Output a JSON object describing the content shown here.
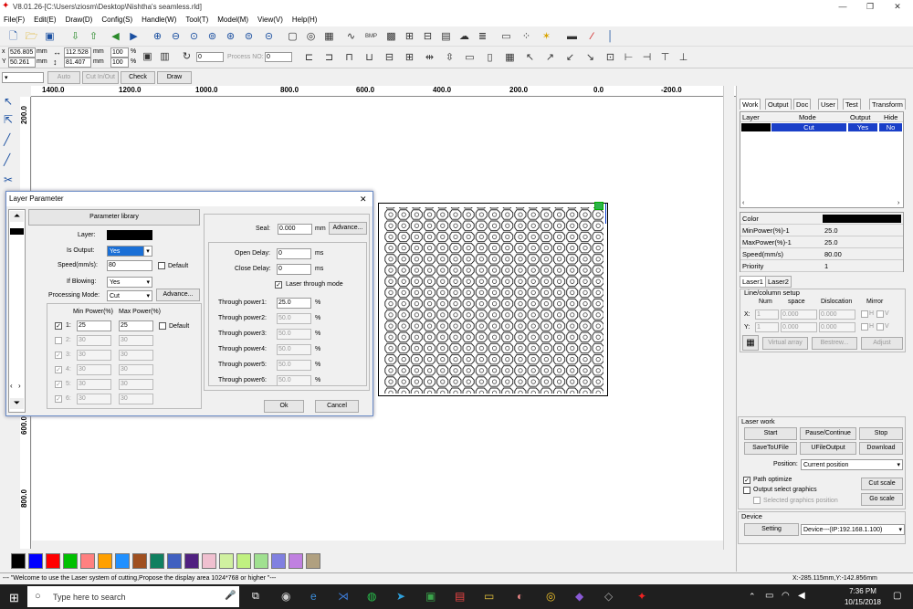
{
  "window": {
    "title": "V8.01.26-[C:\\Users\\ziosm\\Desktop\\Nishtha's seamless.rld]"
  },
  "menu": [
    "File(F)",
    "Edit(E)",
    "Draw(D)",
    "Config(S)",
    "Handle(W)",
    "Tool(T)",
    "Model(M)",
    "View(V)",
    "Help(H)"
  ],
  "toolbar2": {
    "x_val": "526.805",
    "y_val": "50.261",
    "unit": "mm",
    "w_val": "112.528",
    "h_val": "81.407",
    "pct1": "100",
    "pct2": "100",
    "pct": "%",
    "rot_val": "0",
    "process_no_label": "Process NO:",
    "process_no": "0"
  },
  "toolbar3": {
    "auto": "Auto",
    "cut_in_out": "Cut In/Out",
    "check": "Check",
    "draw": "Draw"
  },
  "hruler": [
    "1400.0",
    "1200.0",
    "1000.0",
    "800.0",
    "600.0",
    "400.0",
    "200.0",
    "0.0",
    "-200.0"
  ],
  "vruler": [
    "200.0",
    "600.0",
    "800.0"
  ],
  "right_panel": {
    "tabs": [
      "Work",
      "Output",
      "Doc",
      "User",
      "Test",
      "Transform"
    ],
    "layer_headers": [
      "Layer",
      "Mode",
      "Output",
      "Hide"
    ],
    "layer_row": {
      "mode": "Cut",
      "output": "Yes",
      "hide": "No"
    },
    "props": [
      {
        "k": "Color",
        "v": ""
      },
      {
        "k": "MinPower(%)-1",
        "v": "25.0"
      },
      {
        "k": "MaxPower(%)-1",
        "v": "25.0"
      },
      {
        "k": "Speed(mm/s)",
        "v": "80.00"
      },
      {
        "k": "Priority",
        "v": "1"
      }
    ],
    "laser_tabs": [
      "Laser1",
      "Laser2"
    ],
    "array": {
      "title": "Line/column setup",
      "num": "Num",
      "space": "space",
      "dislocation": "Dislocation",
      "mirror": "Mirror",
      "x": "X:",
      "y": "Y:",
      "x_num": "1",
      "x_space": "0.000",
      "x_disl": "0.000",
      "y_num": "1",
      "y_space": "0.000",
      "y_disl": "0.000",
      "h": "H",
      "v": "V",
      "virtual_array": "Virtual array",
      "bestrew": "Bestrew...",
      "adjust": "Adjust"
    },
    "laser_work": {
      "title": "Laser work",
      "start": "Start",
      "pause": "Pause/Continue",
      "stop": "Stop",
      "save_ufile": "SaveToUFile",
      "ufile_output": "UFileOutput",
      "download": "Download",
      "position_label": "Position:",
      "position_value": "Current position",
      "path_optimize": "Path optimize",
      "output_select": "Output select graphics",
      "selected_pos": "Selected graphics position",
      "cut_scale": "Cut scale",
      "go_scale": "Go scale"
    },
    "device": {
      "title": "Device",
      "setting": "Setting",
      "device_value": "Device---(IP:192.168.1.100)"
    }
  },
  "dialog": {
    "title": "Layer Parameter",
    "param_library": "Parameter library",
    "layer_label": "Layer:",
    "is_output_label": "Is Output:",
    "is_output": "Yes",
    "speed_label": "Speed(mm/s):",
    "speed": "80",
    "default": "Default",
    "if_blowing_label": "If Blowing:",
    "if_blowing": "Yes",
    "proc_mode_label": "Processing Mode:",
    "proc_mode": "Cut",
    "advance": "Advance...",
    "min_power_h": "Min Power(%)",
    "max_power_h": "Max Power(%)",
    "powers": [
      {
        "n": "1:",
        "min": "25",
        "max": "25"
      },
      {
        "n": "2:",
        "min": "30",
        "max": "30"
      },
      {
        "n": "3:",
        "min": "30",
        "max": "30"
      },
      {
        "n": "4:",
        "min": "30",
        "max": "30"
      },
      {
        "n": "5:",
        "min": "30",
        "max": "30"
      },
      {
        "n": "6:",
        "min": "30",
        "max": "30"
      }
    ],
    "seal_label": "Seal:",
    "seal": "0.000",
    "mm": "mm",
    "seal_advance": "Advance...",
    "open_delay_label": "Open Delay:",
    "open_delay": "0",
    "ms": "ms",
    "close_delay_label": "Close Delay:",
    "close_delay": "0",
    "laser_through": "Laser through mode",
    "through": [
      {
        "l": "Through power1:",
        "v": "25.0"
      },
      {
        "l": "Through power2:",
        "v": "50.0"
      },
      {
        "l": "Through power3:",
        "v": "50.0"
      },
      {
        "l": "Through power4:",
        "v": "50.0"
      },
      {
        "l": "Through power5:",
        "v": "50.0"
      },
      {
        "l": "Through power6:",
        "v": "50.0"
      }
    ],
    "ok": "Ok",
    "cancel": "Cancel"
  },
  "colors": [
    "#000000",
    "#0000ff",
    "#ff0000",
    "#00c000",
    "#ff8080",
    "#ffa000",
    "#2090ff",
    "#a05020",
    "#108060",
    "#4060c0",
    "#502080",
    "#f0c0d0",
    "#d0f0a0",
    "#c0f080",
    "#a0e090",
    "#8080e0",
    "#c080e0",
    "#b0a080"
  ],
  "status": {
    "message": "--- \"Welcome to use the Laser system of cutting,Propose the display area 1024*768 or higher \"---",
    "coords": "X:-285.115mm,Y:-142.856mm"
  },
  "taskbar": {
    "search": "Type here to search",
    "time": "7:36 PM",
    "date": "10/15/2018"
  }
}
